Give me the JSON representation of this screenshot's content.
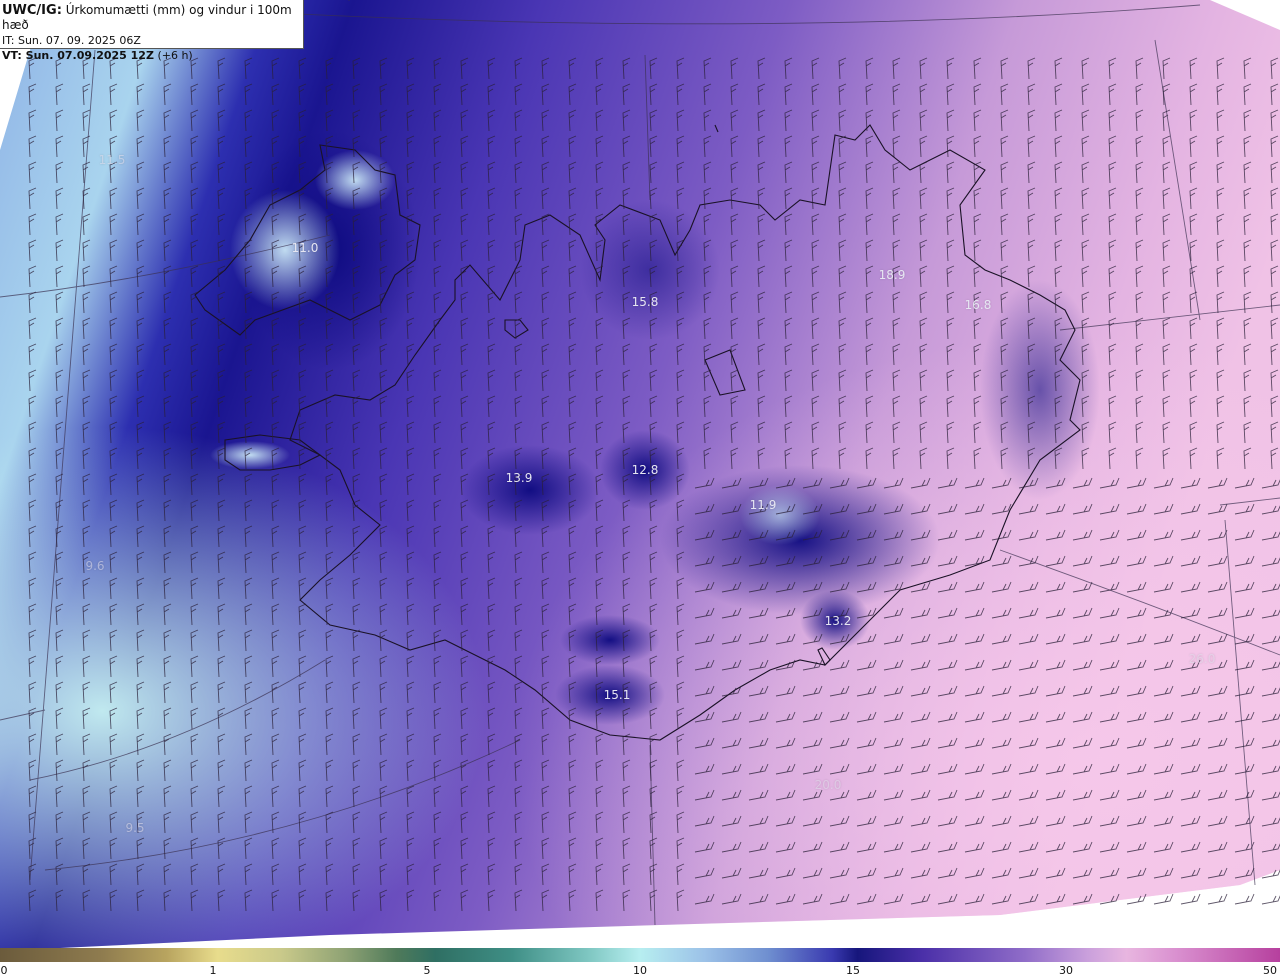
{
  "header": {
    "model_label": "UWC/IG:",
    "title": "Úrkomumætti (mm) og vindur i 100m hæð",
    "init_time": "IT: Sun. 07. 09. 2025 06Z",
    "valid_label": "VT: Sun. 07.09.2025 12Z",
    "valid_offset": "(+6 h)"
  },
  "value_labels": [
    "11.5",
    "11.0",
    "15.8",
    "18.9",
    "16.8",
    "13.9",
    "12.8",
    "11.9",
    "13.2",
    "26.0",
    "15.1",
    "9.6",
    "9.5",
    "20.0"
  ],
  "colorbar": {
    "ticks": [
      "0",
      "1",
      "5",
      "10",
      "15",
      "30",
      "50"
    ],
    "tick_values": [
      0,
      1,
      5,
      10,
      15,
      30,
      50
    ]
  }
}
